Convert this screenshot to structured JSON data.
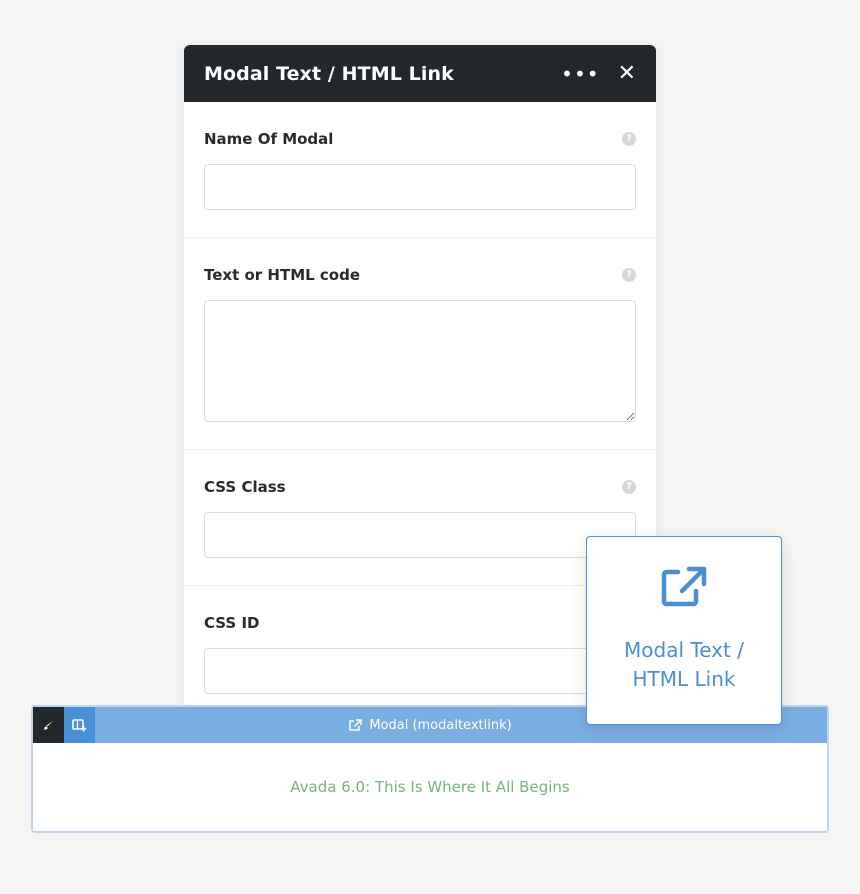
{
  "modal": {
    "title": "Modal Text / HTML Link",
    "more_label": "•••",
    "close_label": "✕",
    "fields": [
      {
        "label": "Name Of Modal",
        "value": "",
        "help": "?"
      },
      {
        "label": "Text or HTML code",
        "value": "",
        "help": "?"
      },
      {
        "label": "CSS Class",
        "value": "",
        "help": "?"
      },
      {
        "label": "CSS ID",
        "value": "",
        "help": "?"
      }
    ]
  },
  "element_bar": {
    "label": "Modal (modaltextlink)",
    "content_text": "Avada 6.0: This Is Where It All Begins"
  },
  "element_card": {
    "label": "Modal Text / HTML Link"
  },
  "colors": {
    "header_bg": "#23282d",
    "bar_bg": "#7aaee2",
    "accent": "#4a90d9",
    "content_text": "#7bb47a"
  }
}
